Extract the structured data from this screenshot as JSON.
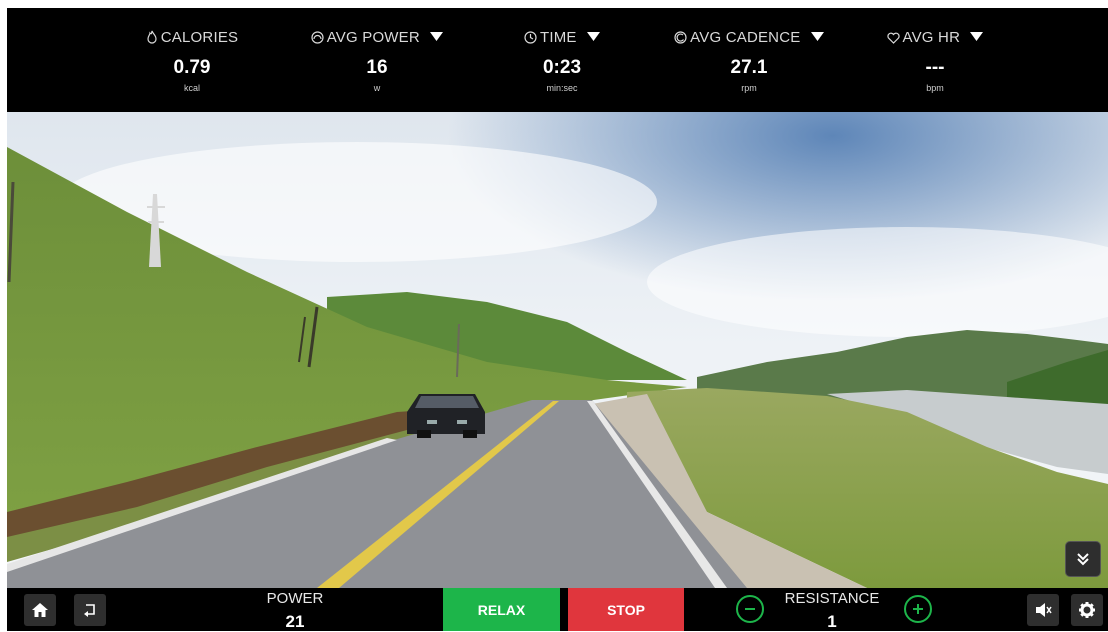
{
  "stats": [
    {
      "icon": "flame-icon",
      "label": "CALORIES",
      "value": "0.79",
      "unit": "kcal",
      "dropdown": false
    },
    {
      "icon": "gauge-icon",
      "label": "AVG POWER",
      "value": "16",
      "unit": "w",
      "dropdown": true
    },
    {
      "icon": "clock-icon",
      "label": "TIME",
      "value": "0:23",
      "unit": "min:sec",
      "dropdown": true
    },
    {
      "icon": "cadence-icon",
      "label": "AVG CADENCE",
      "value": "27.1",
      "unit": "rpm",
      "dropdown": true
    },
    {
      "icon": "heart-icon",
      "label": "AVG HR",
      "value": "---",
      "unit": "bpm",
      "dropdown": true
    }
  ],
  "controls": {
    "power_label": "POWER",
    "power_value": "21",
    "relax_label": "RELAX",
    "stop_label": "STOP",
    "resistance_label": "RESISTANCE",
    "resistance_value": "1"
  },
  "colors": {
    "relax": "#1db54a",
    "stop": "#e0363d",
    "bar": "#000000",
    "button_bg": "#2e2e2e"
  },
  "icons": [
    "home-icon",
    "back-icon",
    "minus-icon",
    "plus-icon",
    "mute-icon",
    "gear-icon",
    "chevron-double-down-icon"
  ]
}
